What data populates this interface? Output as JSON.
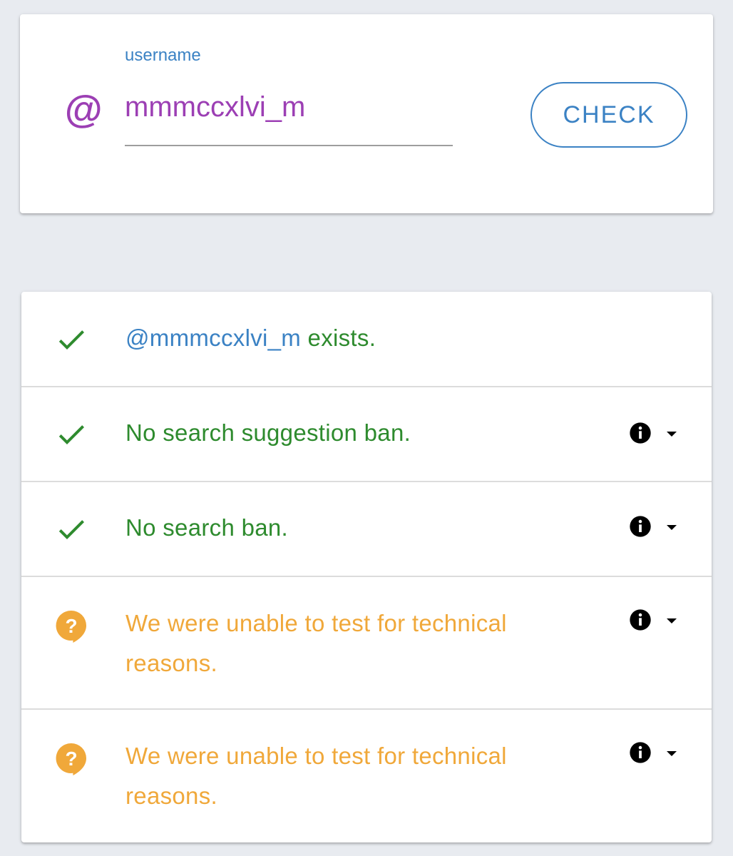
{
  "search": {
    "label": "username",
    "value": "mmmccxlvi_m",
    "at_symbol": "@",
    "button_label": "CHECK"
  },
  "results": [
    {
      "status": "ok",
      "icon": "check-icon",
      "handle": "@mmmccxlvi_m",
      "text": " exists.",
      "has_info": false
    },
    {
      "status": "ok",
      "icon": "check-icon",
      "text": "No search suggestion ban.",
      "has_info": true
    },
    {
      "status": "ok",
      "icon": "check-icon",
      "text": "No search ban.",
      "has_info": true
    },
    {
      "status": "unknown",
      "icon": "question-bubble-icon",
      "text": "We were unable to test for technical reasons.",
      "has_info": true
    },
    {
      "status": "unknown",
      "icon": "question-bubble-icon",
      "text": "We were unable to test for technical reasons.",
      "has_info": true
    }
  ],
  "colors": {
    "accent_blue": "#3b82c4",
    "accent_purple": "#9c3fb4",
    "ok_green": "#2e8b2e",
    "warn_orange": "#f0a83a",
    "background": "#e8ebf0"
  }
}
